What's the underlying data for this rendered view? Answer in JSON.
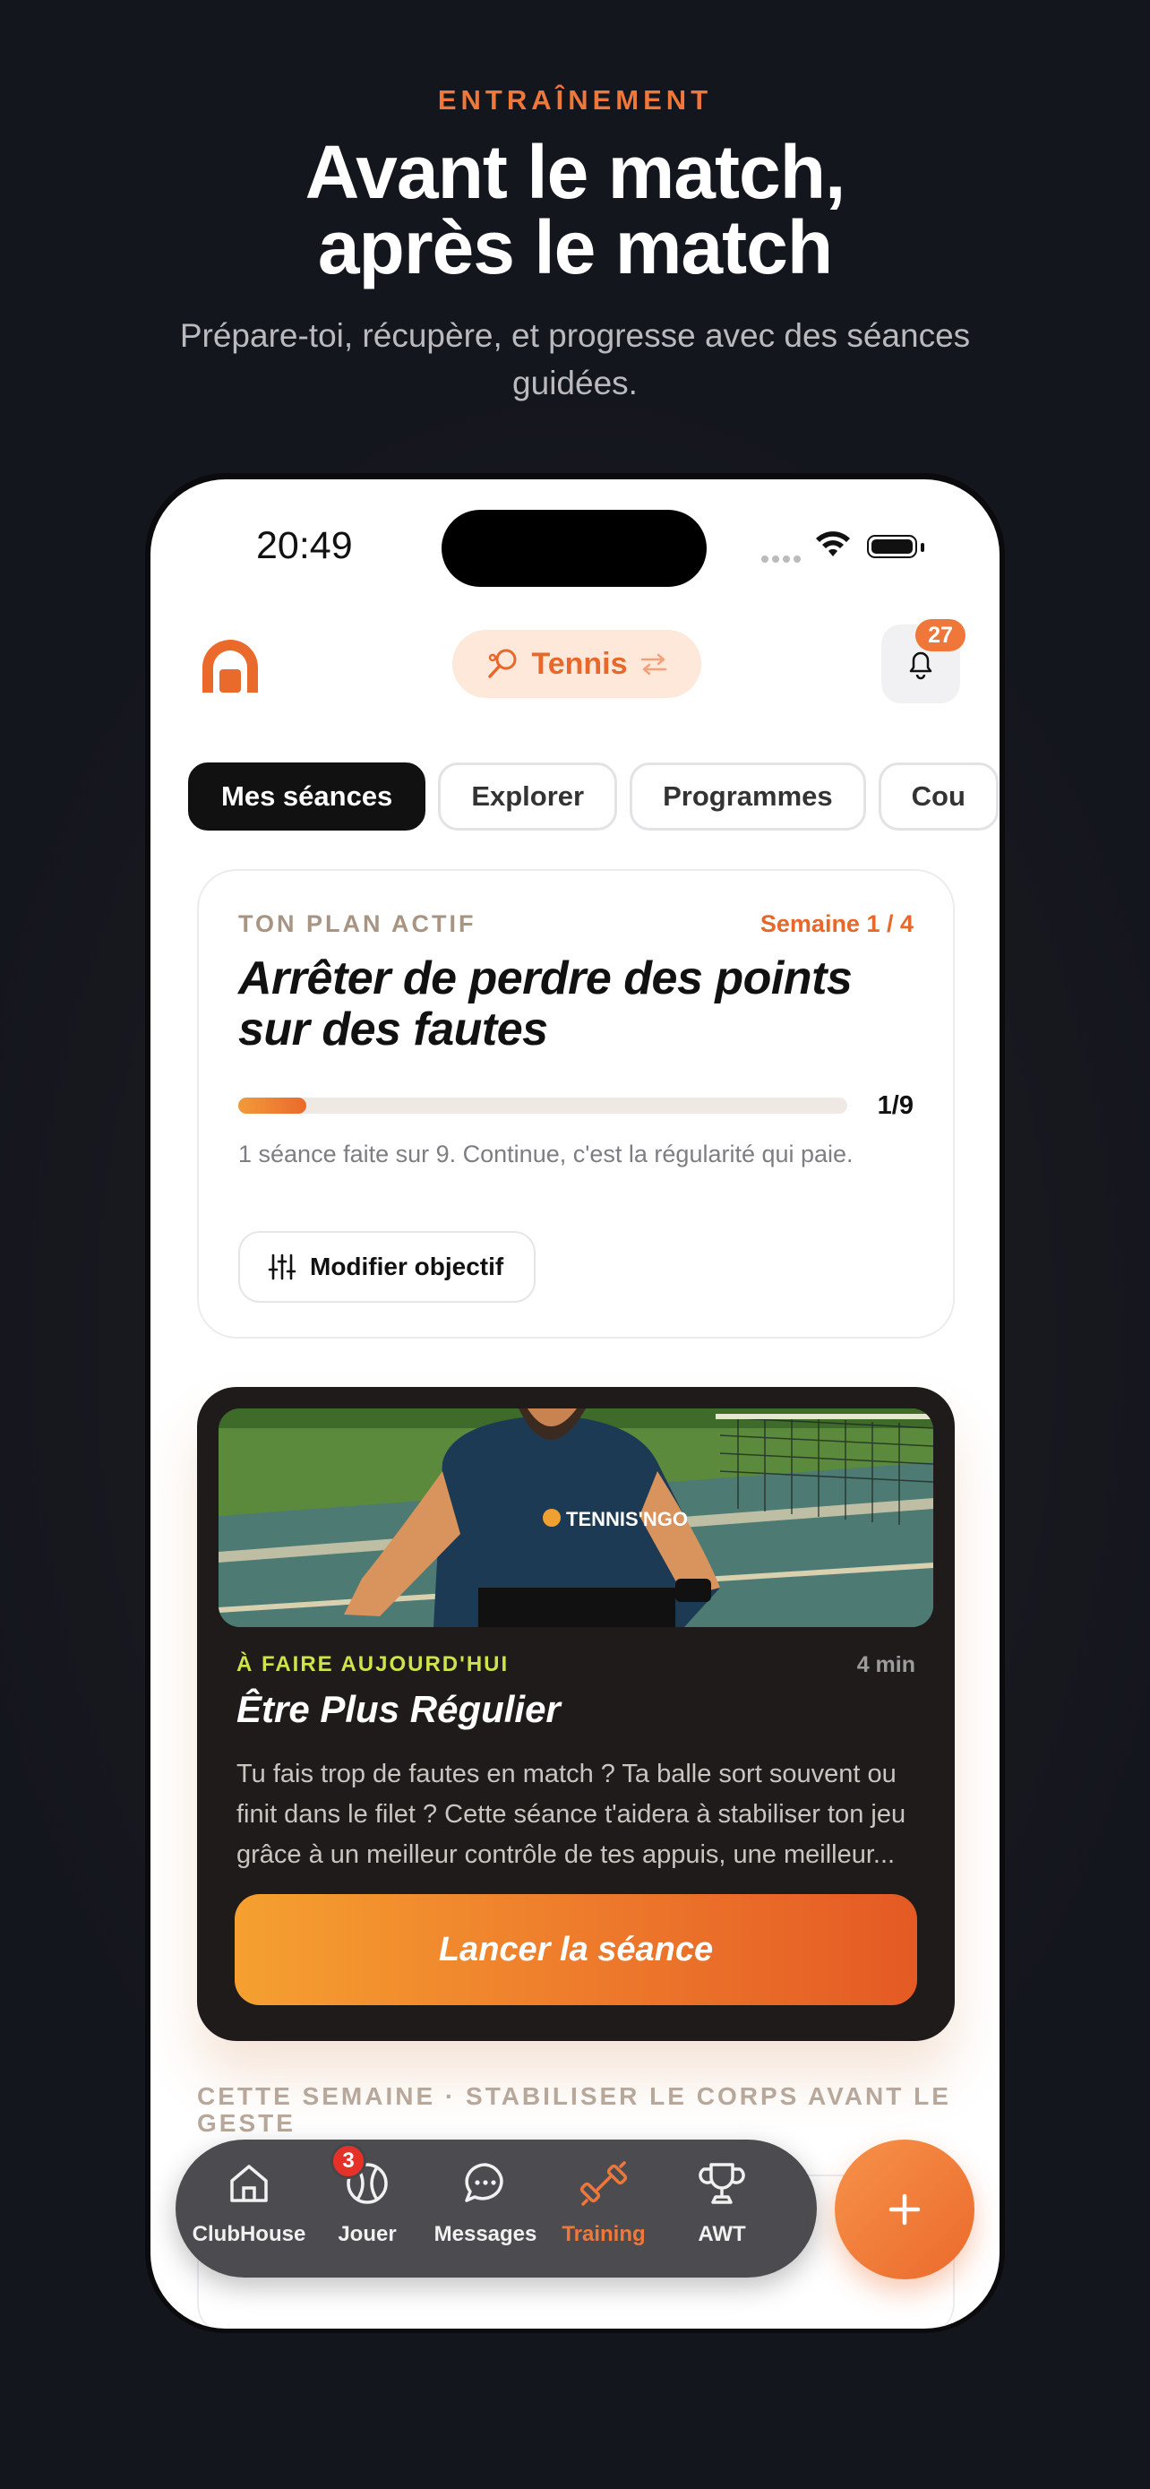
{
  "hero": {
    "eyebrow": "ENTRAÎNEMENT",
    "headline_line1": "Avant le match,",
    "headline_line2": "après le match",
    "subhead": "Prépare-toi, récupère, et progresse avec des séances guidées."
  },
  "status_bar": {
    "time": "20:49"
  },
  "header": {
    "sport": "Tennis",
    "notification_count": "27"
  },
  "tabs": [
    {
      "label": "Mes séances",
      "active": true
    },
    {
      "label": "Explorer",
      "active": false
    },
    {
      "label": "Programmes",
      "active": false
    },
    {
      "label": "Cou",
      "active": false
    }
  ],
  "plan": {
    "label": "TON PLAN ACTIF",
    "week": "Semaine 1 / 4",
    "title": "Arrêter de perdre des points sur des fautes",
    "progress_done": 1,
    "progress_total": 9,
    "progress_text": "1/9",
    "message": "1 séance faite sur 9. Continue, c'est la régularité qui paie.",
    "modify_label": "Modifier objectif"
  },
  "session": {
    "image_brand": "TENNIS'NGO",
    "tag": "À FAIRE AUJOURD'HUI",
    "duration": "4 min",
    "title": "Être Plus Régulier",
    "description": "Tu fais trop de fautes en match ? Ta balle sort souvent ou finit dans le filet ? Cette séance t'aidera à stabiliser ton jeu grâce à un meilleur contrôle de tes appuis, une meilleur...",
    "cta": "Lancer la séance"
  },
  "week_section": {
    "label": "CETTE SEMAINE · STABILISER LE CORPS AVANT LE GESTE"
  },
  "tabbar": {
    "items": [
      {
        "label": "ClubHouse",
        "icon": "home-icon",
        "active": false
      },
      {
        "label": "Jouer",
        "icon": "tennis-ball-icon",
        "active": false
      },
      {
        "label": "Messages",
        "icon": "chat-bubble-icon",
        "active": false
      },
      {
        "label": "Training",
        "icon": "dumbbell-icon",
        "active": true
      },
      {
        "label": "AWT",
        "icon": "trophy-icon",
        "active": false
      }
    ],
    "messages_badge": "3"
  },
  "colors": {
    "accent": "#f0773a",
    "background": "#14161d",
    "today_tag": "#cfe34a"
  }
}
